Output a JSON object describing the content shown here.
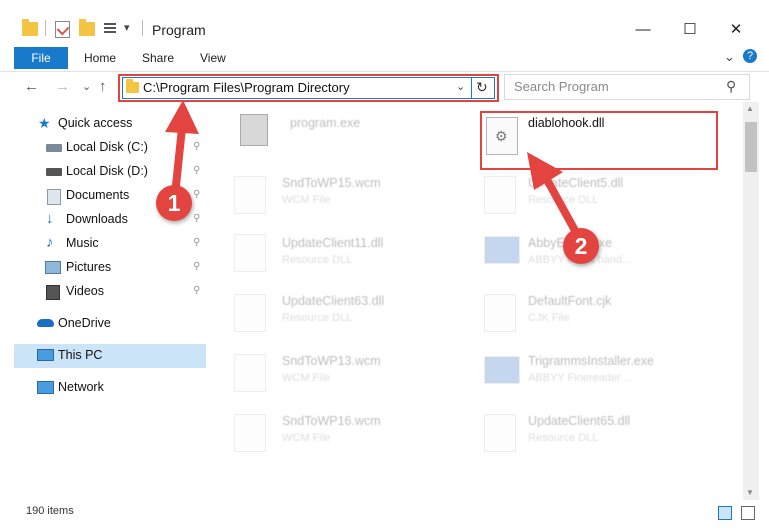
{
  "window": {
    "title": "Program",
    "minimize_glyph": "—",
    "maximize_glyph": "☐",
    "close_glyph": "✕"
  },
  "ribbon": {
    "tabs": [
      "File",
      "Home",
      "Share",
      "View"
    ],
    "expand_glyph": "⌄",
    "help_glyph": "?"
  },
  "address": {
    "path": "C:\\Program Files\\Program Directory",
    "search_placeholder": "Search Program",
    "back_glyph": "←",
    "forward_glyph": "→",
    "up_glyph": "↑",
    "recent_glyph": "⌄",
    "refresh_glyph": "↻",
    "search_glyph": "⚲"
  },
  "nav": {
    "quick_access": "Quick access",
    "items": [
      {
        "label": "Local Disk (C:)",
        "icon": "drive-icon"
      },
      {
        "label": "Local Disk (D:)",
        "icon": "drive-icon"
      },
      {
        "label": "Documents",
        "icon": "documents-icon"
      },
      {
        "label": "Downloads",
        "icon": "downloads-icon"
      },
      {
        "label": "Music",
        "icon": "music-icon"
      },
      {
        "label": "Pictures",
        "icon": "pictures-icon"
      },
      {
        "label": "Videos",
        "icon": "videos-icon"
      }
    ],
    "onedrive": "OneDrive",
    "this_pc": "This PC",
    "network": "Network",
    "pin_glyph": "📌"
  },
  "files": {
    "left": [
      {
        "name": "program.exe",
        "type": ""
      },
      {
        "name": "SndToWP15.wcm",
        "type": "WCM File"
      },
      {
        "name": "UpdateClient11.dll",
        "type": "Resource DLL"
      },
      {
        "name": "UpdateClient63.dll",
        "type": "Resource DLL"
      },
      {
        "name": "SndToWP13.wcm",
        "type": "WCM File"
      },
      {
        "name": "SndToWP16.wcm",
        "type": "WCM File"
      }
    ],
    "right": [
      {
        "name": "diablohook.dll",
        "type": ""
      },
      {
        "name": "UpdateClient5.dll",
        "type": "Resource DLL"
      },
      {
        "name": "AbbyEvent.exe",
        "type": "ABBYY event hand..."
      },
      {
        "name": "DefaultFont.cjk",
        "type": "CJK File"
      },
      {
        "name": "TrigrammsInstaller.exe",
        "type": "ABBYY Finereader ..."
      },
      {
        "name": "UpdateClient65.dll",
        "type": "Resource DLL"
      }
    ]
  },
  "status": {
    "count": "190 items"
  },
  "annotations": {
    "step1": "1",
    "step2": "2",
    "color": "#e4443f"
  }
}
